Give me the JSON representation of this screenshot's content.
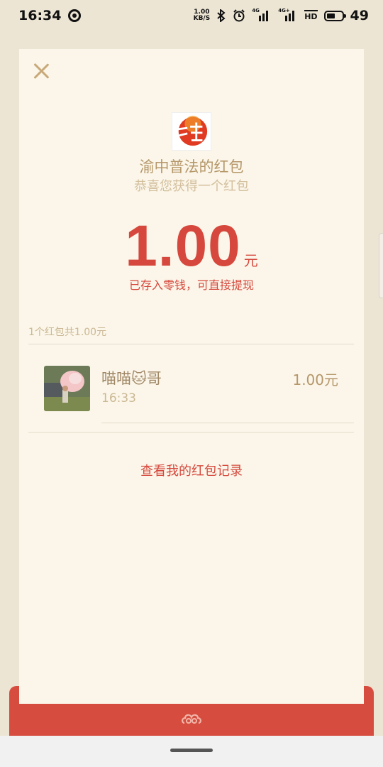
{
  "status_bar": {
    "time": "16:34",
    "net_speed_value": "1.00",
    "net_speed_unit": "KB/S",
    "signal1_label": "4G",
    "signal2_label": "4G+",
    "hd_label": "HD",
    "battery_level": "49"
  },
  "packet": {
    "sender_title": "渝中普法的红包",
    "greeting": "恭喜您获得一个红包",
    "amount": "1.00",
    "unit": "元",
    "deposit_note": "已存入零钱，可直接提现",
    "summary": "1个红包共1.00元"
  },
  "records": [
    {
      "name": "喵喵🐱哥",
      "time": "16:33",
      "amount": "1.00元"
    }
  ],
  "history_link": "查看我的红包记录",
  "colors": {
    "accent_red": "#d6483d",
    "card_background": "#fbf6e9",
    "gold_text": "#b6976a"
  },
  "icons": {
    "close": "close-icon",
    "logo": "sender-logo",
    "bottom": "cloud-ornament-icon"
  }
}
